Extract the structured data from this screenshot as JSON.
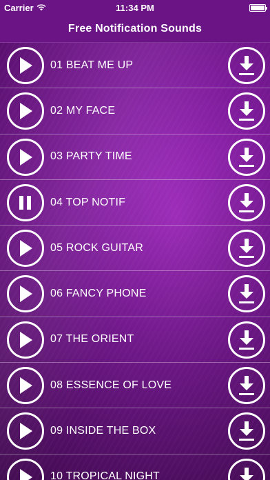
{
  "status_bar": {
    "carrier": "Carrier",
    "time": "11:34 PM"
  },
  "nav": {
    "title": "Free Notification Sounds"
  },
  "tracks": [
    {
      "label": "01 BEAT ME UP",
      "state": "play"
    },
    {
      "label": "02 MY FACE",
      "state": "play"
    },
    {
      "label": "03 PARTY TIME",
      "state": "play"
    },
    {
      "label": "04 TOP NOTIF",
      "state": "pause"
    },
    {
      "label": "05 ROCK GUITAR",
      "state": "play"
    },
    {
      "label": "06 FANCY PHONE",
      "state": "play"
    },
    {
      "label": "07 THE ORIENT",
      "state": "play"
    },
    {
      "label": "08 ESSENCE OF LOVE",
      "state": "play"
    },
    {
      "label": "09 INSIDE THE BOX",
      "state": "play"
    },
    {
      "label": "10 TROPICAL NIGHT",
      "state": "play"
    }
  ],
  "colors": {
    "accent": "#ffffff",
    "background": "#7d1b9a"
  }
}
